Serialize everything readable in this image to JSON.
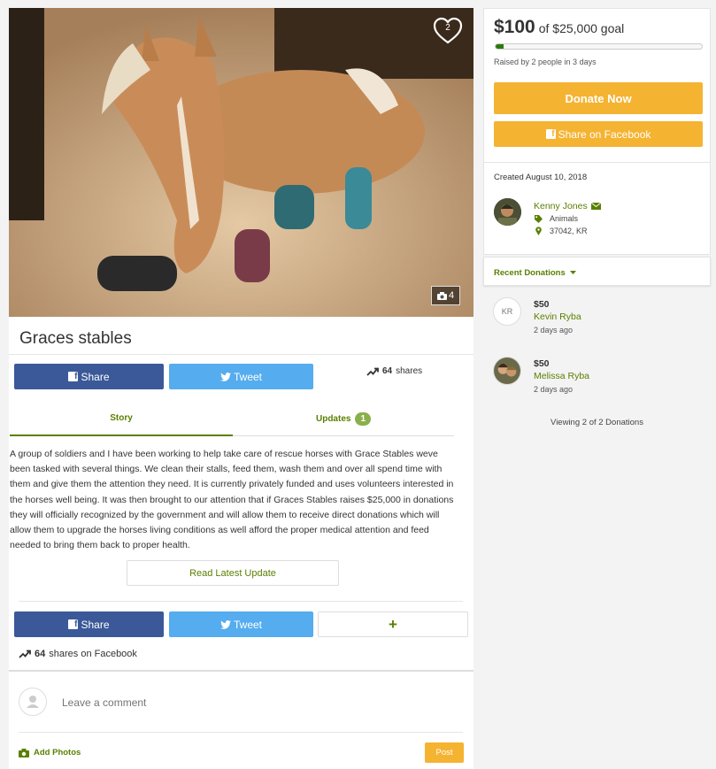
{
  "campaign": {
    "title": "Graces stables",
    "likes": "2",
    "photo_count": "4"
  },
  "share_top": {
    "facebook": "Share",
    "twitter": "Tweet",
    "share_count": "64",
    "share_suffix": "shares"
  },
  "tabs": {
    "story": "Story",
    "updates": "Updates",
    "updates_count": "1"
  },
  "story": {
    "text": "A group of soldiers and I have been working to help take care of rescue horses with Grace Stables weve been tasked with several things. We clean their stalls, feed them, wash them and over all spend time with them and give them the attention they need. It is currently privately funded and uses volunteers interested in the horses well being. It was then brought to our attention that if Graces Stables raises $25,000 in donations they will officially recognized by the government and will allow them to receive direct donations which will allow them to upgrade the horses living conditions as well afford the proper medical attention and feed needed to bring them back to proper health.",
    "read_update": "Read Latest Update"
  },
  "share_bottom": {
    "facebook": "Share",
    "twitter": "Tweet",
    "plus": "+",
    "share_count": "64",
    "share_suffix": "shares on Facebook"
  },
  "comment": {
    "placeholder": "Leave a comment",
    "add_photos": "Add Photos",
    "post": "Post"
  },
  "funding": {
    "raised": "$100",
    "goal_text": "of $25,000 goal",
    "progress_fraction": 0.004,
    "raised_by": "Raised by 2 people in 3 days",
    "donate": "Donate Now",
    "share_facebook": "Share on Facebook"
  },
  "organizer": {
    "created": "Created August 10, 2018",
    "name": "Kenny Jones",
    "category": "Animals",
    "location": "37042, KR"
  },
  "donations": {
    "header": "Recent Donations",
    "items": [
      {
        "initials": "KR",
        "amount": "$50",
        "name": "Kevin Ryba",
        "time": "2 days ago"
      },
      {
        "initials": "",
        "amount": "$50",
        "name": "Melissa Ryba",
        "time": "2 days ago"
      }
    ],
    "viewing": "Viewing 2 of 2 Donations"
  },
  "colors": {
    "accent_green": "#5a7f00",
    "donate_orange": "#f5b332",
    "facebook_blue": "#3b5998",
    "twitter_blue": "#55acee"
  }
}
